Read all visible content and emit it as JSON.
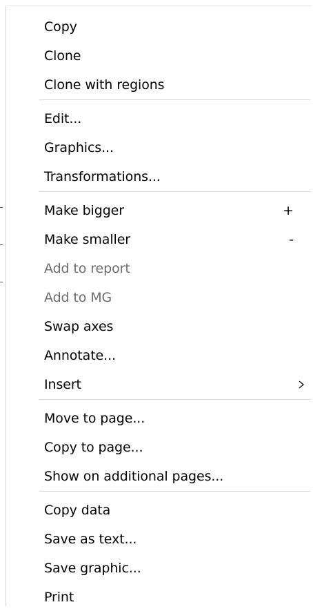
{
  "menu": {
    "groups": [
      {
        "items": [
          {
            "label": "Copy",
            "shortcut": "",
            "enabled": true
          },
          {
            "label": "Clone",
            "shortcut": "",
            "enabled": true
          },
          {
            "label": "Clone with regions",
            "shortcut": "",
            "enabled": true
          }
        ]
      },
      {
        "items": [
          {
            "label": "Edit...",
            "shortcut": "",
            "enabled": true
          },
          {
            "label": "Graphics...",
            "shortcut": "",
            "enabled": true
          },
          {
            "label": "Transformations...",
            "shortcut": "",
            "enabled": true
          }
        ]
      },
      {
        "items": [
          {
            "label": "Make bigger",
            "shortcut": "+",
            "enabled": true
          },
          {
            "label": "Make smaller",
            "shortcut": "-",
            "enabled": true
          },
          {
            "label": "Add to report",
            "shortcut": "",
            "enabled": false
          },
          {
            "label": "Add to MG",
            "shortcut": "",
            "enabled": false
          },
          {
            "label": "Swap axes",
            "shortcut": "",
            "enabled": true
          },
          {
            "label": "Annotate...",
            "shortcut": "",
            "enabled": true
          },
          {
            "label": "Insert",
            "shortcut": "",
            "enabled": true,
            "submenu": true
          }
        ]
      },
      {
        "items": [
          {
            "label": "Move to page...",
            "shortcut": "",
            "enabled": true
          },
          {
            "label": "Copy to page...",
            "shortcut": "",
            "enabled": true
          },
          {
            "label": "Show on additional pages...",
            "shortcut": "",
            "enabled": true
          }
        ]
      },
      {
        "items": [
          {
            "label": "Copy data",
            "shortcut": "",
            "enabled": true
          },
          {
            "label": "Save as text...",
            "shortcut": "",
            "enabled": true
          },
          {
            "label": "Save graphic...",
            "shortcut": "",
            "enabled": true
          },
          {
            "label": "Print",
            "shortcut": "",
            "enabled": true
          }
        ]
      }
    ],
    "icons": {
      "submenu_arrow": "chevron-right-icon"
    },
    "colors": {
      "background": "#ffffff",
      "text": "#000000",
      "disabled_text": "#6d6d6d",
      "separator": "#d8d8d8"
    }
  }
}
